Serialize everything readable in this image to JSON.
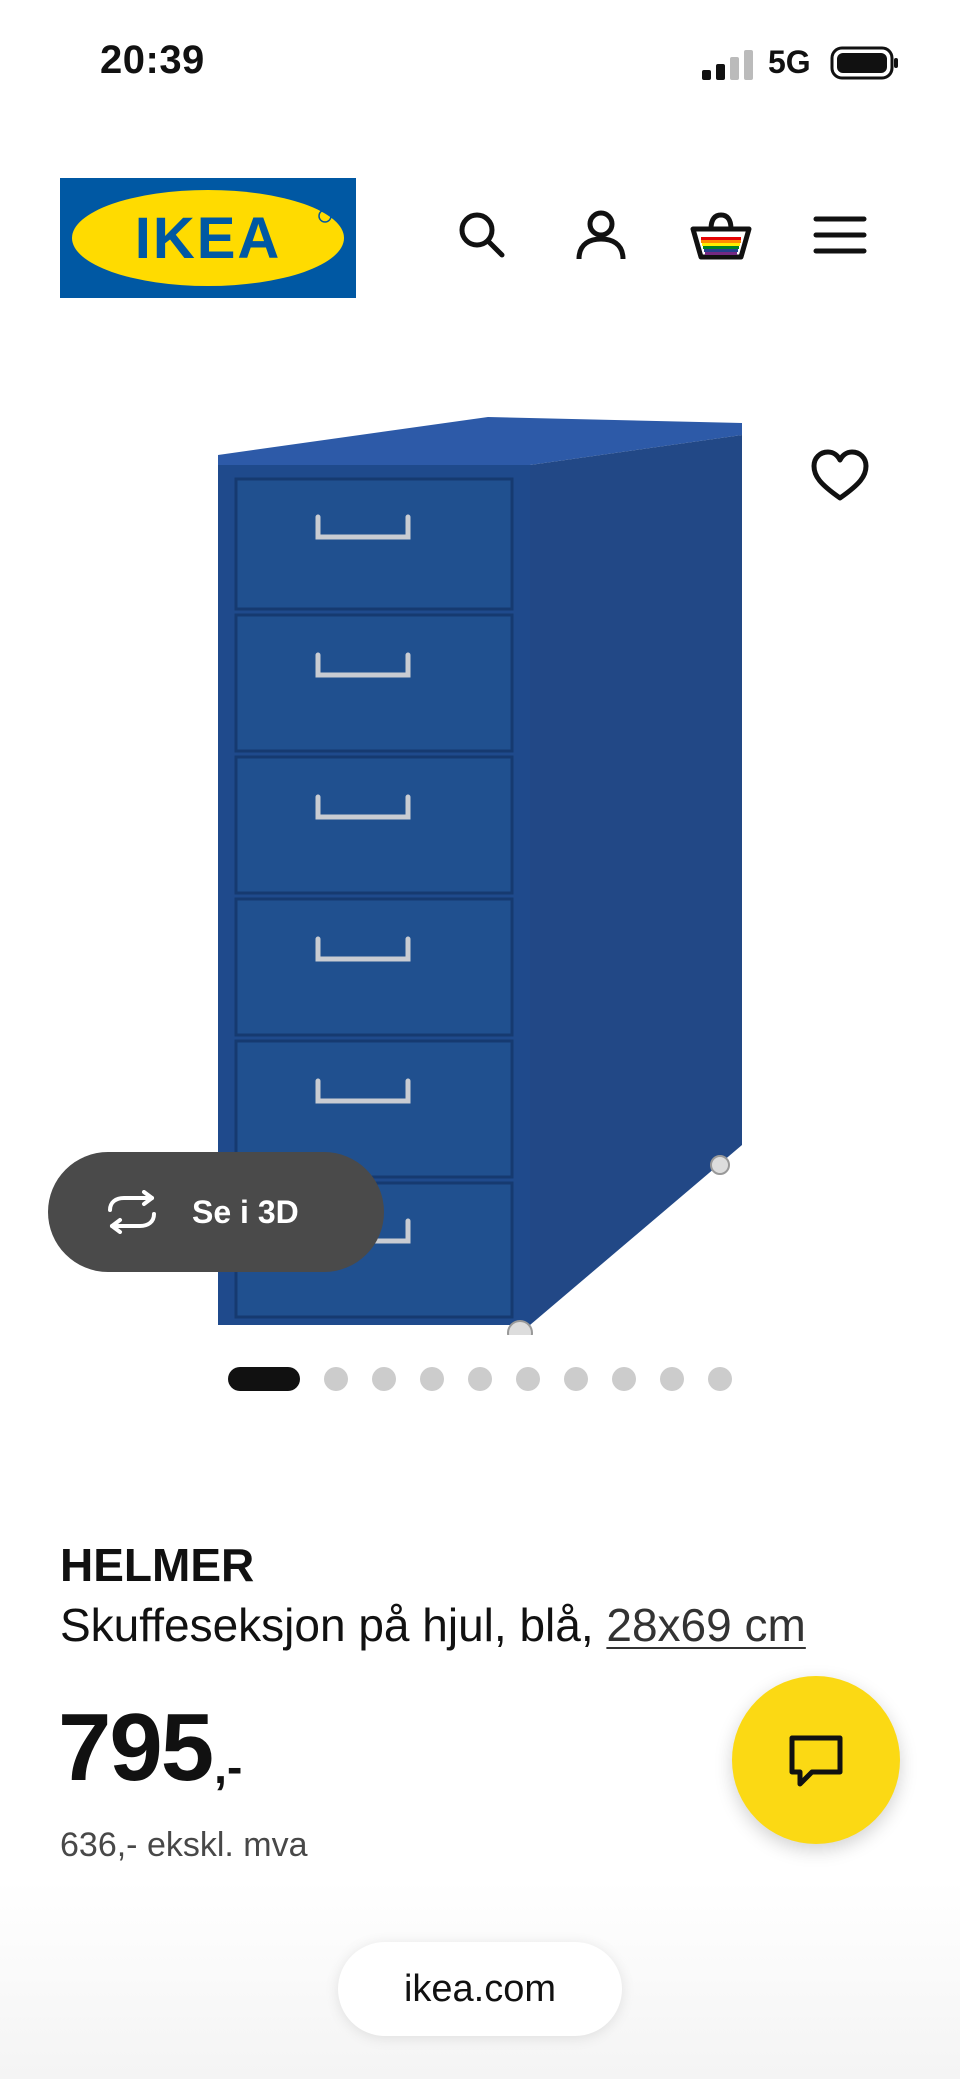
{
  "status_bar": {
    "time": "20:39",
    "network": "5G",
    "signal_icon": "cellular-signal-icon",
    "battery_icon": "battery-icon"
  },
  "header": {
    "logo_text": "IKEA",
    "logo_colors": {
      "blue": "#0058A3",
      "yellow": "#FFDB00"
    },
    "icons": [
      "search-icon",
      "account-icon",
      "cart-icon",
      "menu-icon"
    ]
  },
  "gallery": {
    "see_3d_label": "Se i 3D",
    "see_3d_icon": "rotate-3d-icon",
    "wishlist_icon": "heart-icon",
    "product_color": "#1f4a8c",
    "image_count": 10,
    "active_index": 0
  },
  "product": {
    "name": "HELMER",
    "description": "Skuffeseksjon på hjul, blå, ",
    "size": "28x69 cm",
    "price_integer": "795",
    "price_suffix": ",-",
    "price_excl_vat": "636,- ekskl. mva"
  },
  "chat": {
    "icon": "chat-bubble-icon",
    "color": "#FBD914"
  },
  "browser": {
    "url": "ikea.com"
  }
}
